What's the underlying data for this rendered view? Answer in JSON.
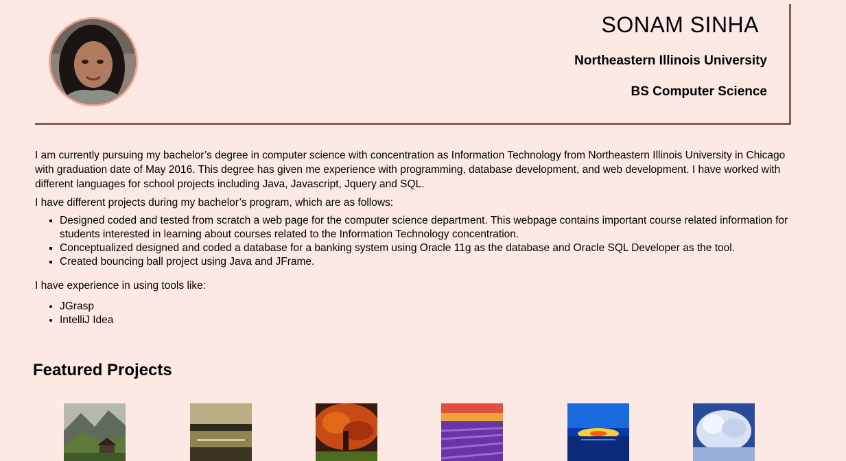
{
  "profile": {
    "name": "SONAM SINHA",
    "university": "Northeastern Illinois University",
    "degree": "BS Computer Science"
  },
  "bio": {
    "intro": "I am currently pursuing my bachelor’s degree in computer science with concentration as Information Technology from Northeastern Illinois University in Chicago with graduation date of May 2016. This degree has given me experience with programming, database development, and web development. I have worked with different languages for school projects including Java, Javascript, Jquery and SQL.",
    "projects_intro": "I have different projects during my bachelor’s program, which are as follows:",
    "projects": [
      "Designed coded and tested from scratch a web page for the computer science department. This webpage contains important course related information for students interested in learning about courses related to the Information Technology concentration.",
      "Conceptualized designed and coded a database for a banking system using Oracle 11g as the database and Oracle SQL Developer as the tool.",
      "Created bouncing ball project using Java and JFrame."
    ],
    "tools_intro": "I have experience in using tools like:",
    "tools": [
      "JGrasp",
      "IntelliJ Idea"
    ]
  },
  "featured": {
    "title": "Featured Projects",
    "thumbnails": [
      "mountain-cabin",
      "lake-sunset",
      "autumn-tree",
      "lavender-field",
      "ocean-sunset",
      "snowy-tree"
    ]
  },
  "colors": {
    "background": "#fde9e3",
    "header_border": "#8a5a55",
    "avatar_ring": "#f4a08d"
  }
}
